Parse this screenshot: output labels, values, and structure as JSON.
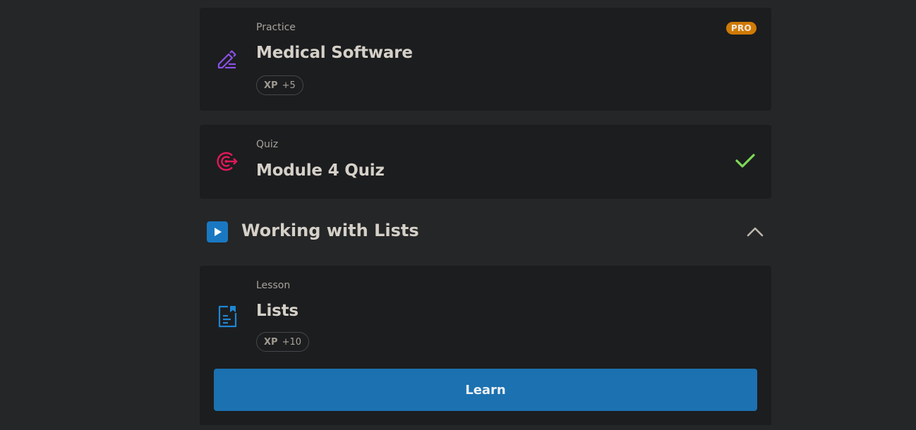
{
  "practice": {
    "type_label": "Practice",
    "title": "Medical Software",
    "xp_key": "XP",
    "xp_value": "+5",
    "badge": "PRO",
    "icon": "pencil-lines-icon"
  },
  "quiz": {
    "type_label": "Quiz",
    "title": "Module 4 Quiz",
    "icon": "target-arrow-icon",
    "status": "completed"
  },
  "module": {
    "title": "Working with Lists",
    "icon": "play-icon",
    "expanded": true
  },
  "lesson": {
    "type_label": "Lesson",
    "title": "Lists",
    "xp_key": "XP",
    "xp_value": "+10",
    "icon": "document-bookmark-icon",
    "button_label": "Learn"
  },
  "colors": {
    "background": "#252627",
    "card": "#1c1d1f",
    "accent_blue": "#1c71b0",
    "pro_orange": "#cf7a06",
    "check_green": "#7ed957",
    "practice_purple": "#8a52e8",
    "quiz_pink": "#e4175a"
  }
}
